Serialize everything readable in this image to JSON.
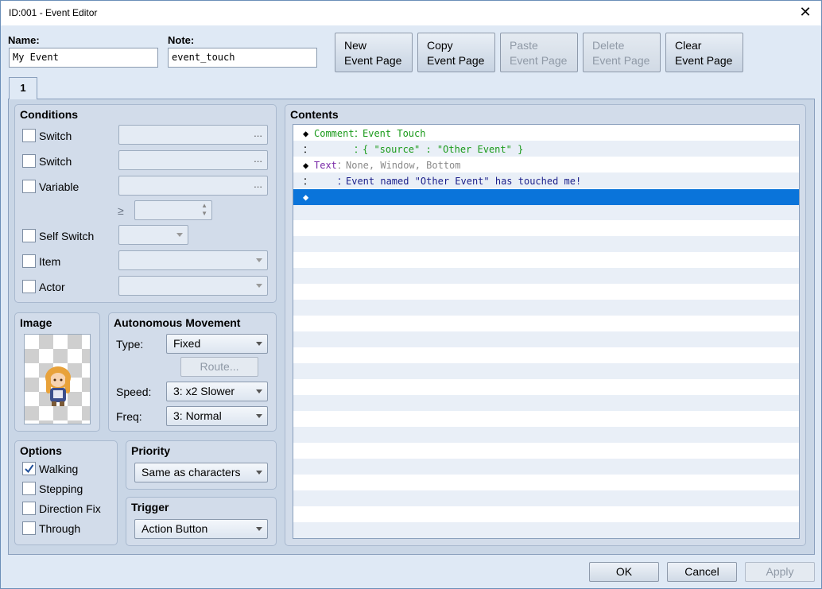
{
  "window": {
    "title": "ID:001 - Event Editor",
    "close": "✕"
  },
  "name": {
    "label": "Name:",
    "value": "My Event"
  },
  "note": {
    "label": "Note:",
    "value": "event_touch"
  },
  "toolbar": {
    "new": [
      "New",
      "Event Page"
    ],
    "copy": [
      "Copy",
      "Event Page"
    ],
    "paste": [
      "Paste",
      "Event Page"
    ],
    "delete": [
      "Delete",
      "Event Page"
    ],
    "clear": [
      "Clear",
      "Event Page"
    ]
  },
  "tabs": [
    {
      "label": "1"
    }
  ],
  "conditions": {
    "title": "Conditions",
    "switch1": "Switch",
    "switch2": "Switch",
    "variable": "Variable",
    "gte": "≥",
    "self_switch": "Self Switch",
    "item": "Item",
    "actor": "Actor",
    "dots": "..."
  },
  "image": {
    "title": "Image"
  },
  "movement": {
    "title": "Autonomous Movement",
    "type_label": "Type:",
    "type_value": "Fixed",
    "route": "Route...",
    "speed_label": "Speed:",
    "speed_value": "3: x2 Slower",
    "freq_label": "Freq:",
    "freq_value": "3: Normal"
  },
  "options": {
    "title": "Options",
    "walking": "Walking",
    "stepping": "Stepping",
    "direction_fix": "Direction Fix",
    "through": "Through"
  },
  "priority": {
    "title": "Priority",
    "value": "Same as characters"
  },
  "trigger": {
    "title": "Trigger",
    "value": "Action Button"
  },
  "contents": {
    "title": "Contents",
    "rows": [
      {
        "marker": "◆",
        "cmd": "Comment",
        "sep": "：",
        "text": "Event Touch"
      },
      {
        "marker": "：",
        "cmd": "",
        "sep": "：",
        "text": "{ \"source\" : \"Other Event\" }"
      },
      {
        "marker": "◆",
        "cmd": "Text",
        "sep": "：",
        "text": "None, Window, Bottom"
      },
      {
        "marker": "：",
        "cmd": "",
        "sep": "：",
        "text": "Event named \"Other Event\" has touched me!"
      },
      {
        "marker": "◆",
        "cmd": "",
        "sep": "",
        "text": ""
      }
    ]
  },
  "footer": {
    "ok": "OK",
    "cancel": "Cancel",
    "apply": "Apply"
  },
  "colors": {
    "selection": "#0a74da",
    "comment": "#1a9a1a",
    "text_cmd": "#7a2aa8"
  }
}
